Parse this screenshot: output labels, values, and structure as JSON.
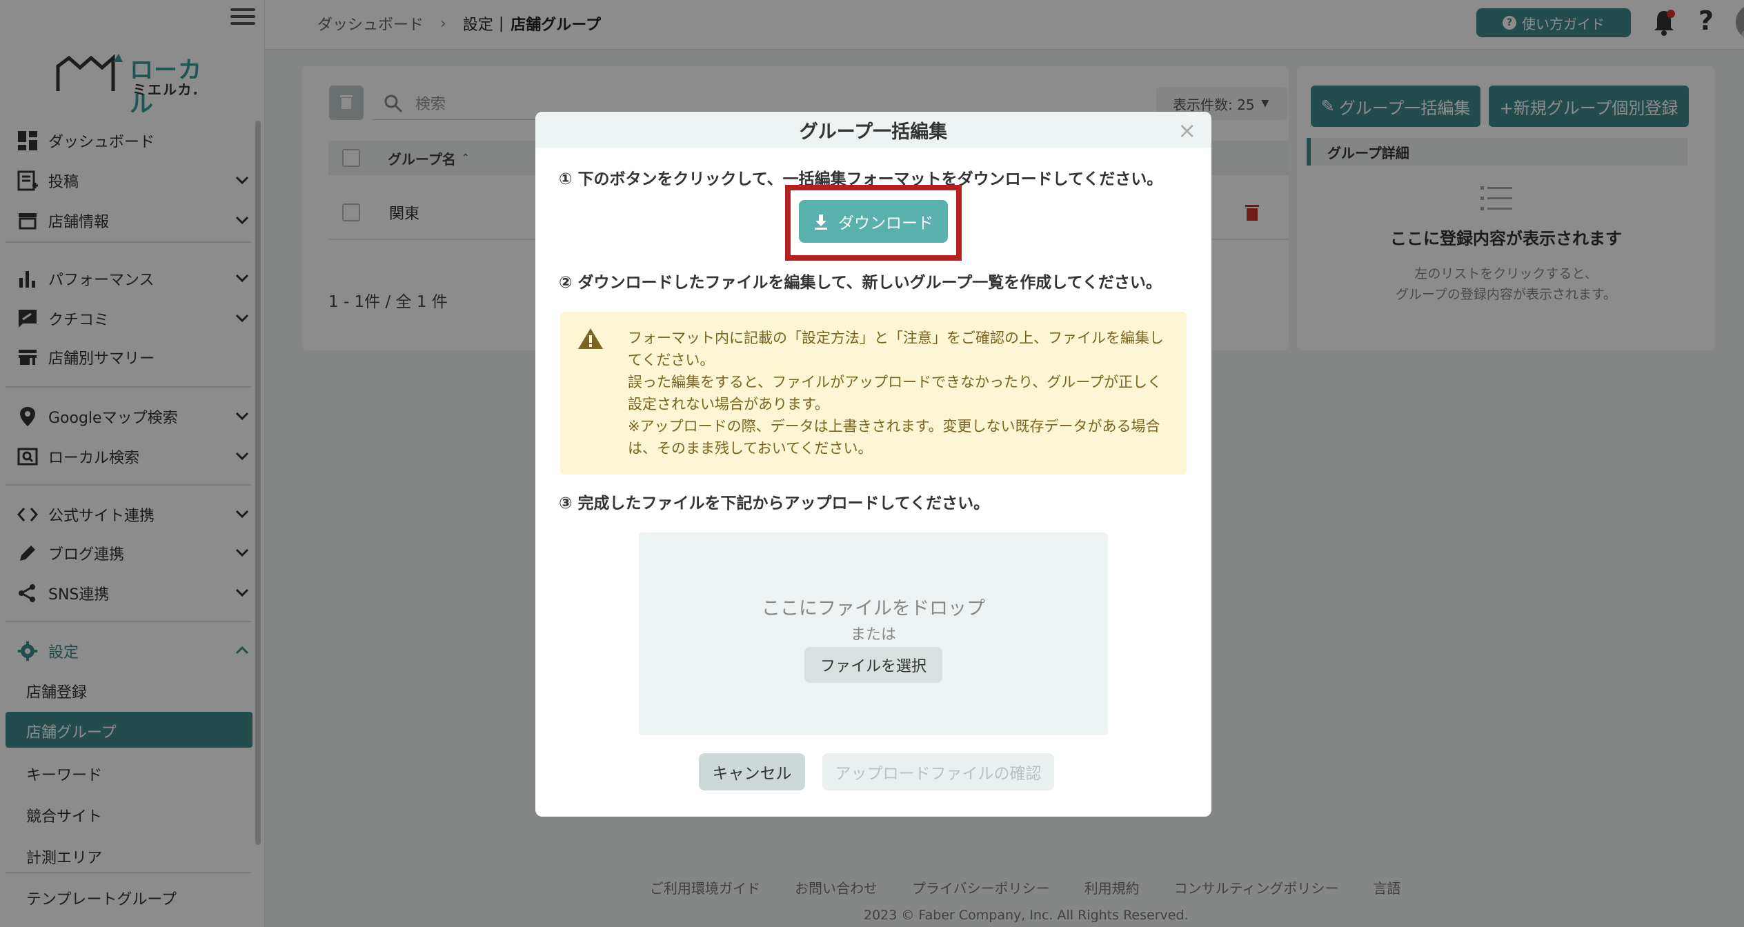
{
  "logo": {
    "line1": "ローカル",
    "line2": "ミエルカ."
  },
  "sidebar": {
    "items": [
      {
        "label": "ダッシュボード",
        "icon": "dashboard-icon"
      },
      {
        "label": "投稿",
        "icon": "post-icon"
      },
      {
        "label": "店舗情報",
        "icon": "store-icon"
      },
      {
        "label": "パフォーマンス",
        "icon": "bar-chart-icon"
      },
      {
        "label": "クチコミ",
        "icon": "review-icon"
      },
      {
        "label": "店舗別サマリー",
        "icon": "store-summary-icon"
      },
      {
        "label": "Googleマップ検索",
        "icon": "map-pin-icon"
      },
      {
        "label": "ローカル検索",
        "icon": "local-search-icon"
      },
      {
        "label": "公式サイト連携",
        "icon": "code-icon"
      },
      {
        "label": "ブログ連携",
        "icon": "pencil-icon"
      },
      {
        "label": "SNS連携",
        "icon": "share-icon"
      },
      {
        "label": "設定",
        "icon": "gear-icon"
      }
    ],
    "settings_sub": [
      "店舗登録",
      "店舗グループ",
      "キーワード",
      "競合サイト",
      "計測エリア",
      "テンプレートグループ"
    ]
  },
  "header": {
    "breadcrumb_home": "ダッシュボード",
    "breadcrumb_parent": "設定",
    "breadcrumb_divider": "|",
    "breadcrumb_current": "店舗グループ",
    "guide_label": "使い方ガイド",
    "help_label": "?"
  },
  "main": {
    "search_placeholder": "検索",
    "count_label": "表示件数: 25",
    "bulk_edit_label": "グループ一括編集",
    "new_group_label": "+新規グループ個別登録",
    "column_group_name": "グループ名",
    "rows": [
      {
        "name": "関東"
      }
    ],
    "pager": "1 - 1件 / 全 1 件",
    "detail_title": "グループ詳細",
    "detail_empty": "ここに登録内容が表示されます",
    "detail_sub_1": "左のリストをクリックすると、",
    "detail_sub_2": "グループの登録内容が表示されます。"
  },
  "footer": {
    "links": [
      "ご利用環境ガイド",
      "お問い合わせ",
      "プライバシーポリシー",
      "利用規約",
      "コンサルティングポリシー",
      "言語"
    ],
    "copyright": "2023 © Faber Company, Inc. All Rights Reserved."
  },
  "modal": {
    "title": "グループ一括編集",
    "close": "×",
    "step1": "① 下のボタンをクリックして、一括編集フォーマットをダウンロードしてください。",
    "download_label": "ダウンロード",
    "step2": "② ダウンロードしたファイルを編集して、新しいグループ一覧を作成してください。",
    "warning_lines": [
      "フォーマット内に記載の「設定方法」と「注意」をご確認の上、ファイルを編集してください。",
      "誤った編集をすると、ファイルがアップロードできなかったり、グループが正しく設定されない場合があります。",
      "※アップロードの際、データは上書きされます。変更しない既存データがある場合は、そのまま残しておいてください。"
    ],
    "step3": "③ 完成したファイルを下記からアップロードしてください。",
    "drop_text": "ここにファイルをドロップ",
    "drop_or": "または",
    "select_file": "ファイルを選択",
    "cancel": "キャンセル",
    "confirm": "アップロードファイルの確認"
  },
  "colors": {
    "accent": "#3f8d8a",
    "download": "#58b1ac",
    "highlight": "#b5211e",
    "warning_bg": "#fdf6d4"
  }
}
